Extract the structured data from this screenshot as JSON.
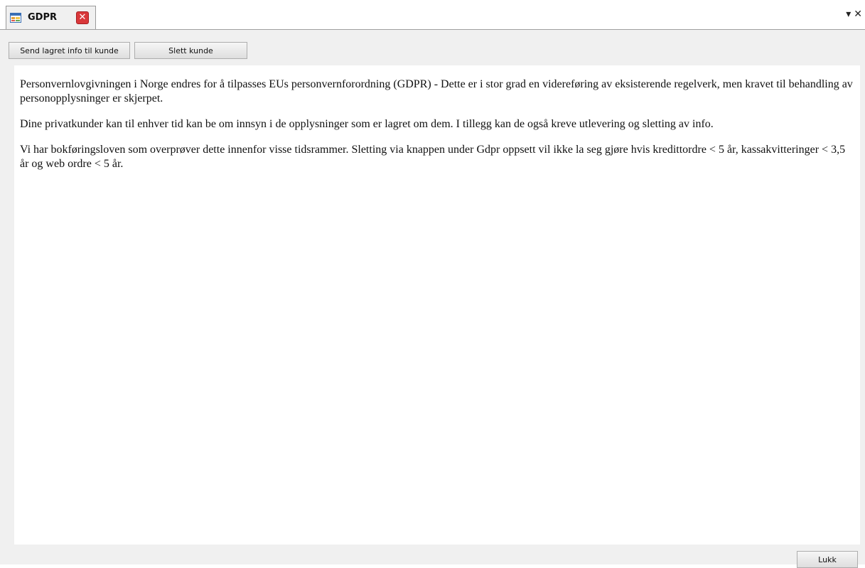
{
  "tab": {
    "title": "GDPR",
    "close_icon": "close-icon",
    "app_icon": "form-icon"
  },
  "window_controls": {
    "dropdown_glyph": "▾",
    "close_glyph": "✕"
  },
  "toolbar": {
    "send_label": "Send lagret info til kunde",
    "delete_label": "Slett kunde"
  },
  "content": {
    "paragraphs": [
      "Personvernlovgivningen i Norge endres for å tilpasses EUs personvernforordning (GDPR) - Dette er i stor grad en videreføring av eksisterende regelverk, men kravet til behandling av personopplysninger er skjerpet.",
      "Dine privatkunder kan til enhver tid kan be om innsyn i de opplysninger som er lagret om dem. I tillegg kan de også kreve utlevering og sletting av info.",
      "Vi har bokføringsloven som overprøver dette innenfor visse tidsrammer. Sletting via knappen under Gdpr oppsett vil ikke la seg gjøre hvis kredittordre < 5 år, kassakvitteringer < 3,5 år og web ordre < 5 år."
    ]
  },
  "footer": {
    "close_label": "Lukk"
  },
  "colors": {
    "tab_close_bg": "#d9383a",
    "panel_bg": "#f0f0f0",
    "content_bg": "#ffffff"
  }
}
